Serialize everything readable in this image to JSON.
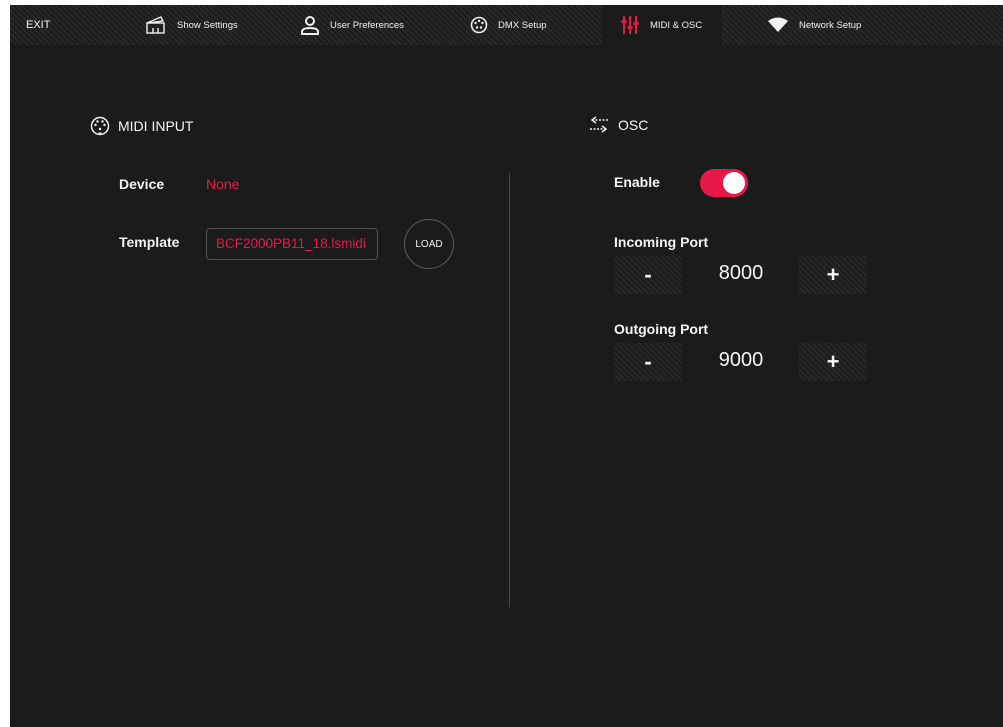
{
  "nav": {
    "exit_label": "EXIT",
    "tabs": [
      {
        "label": "Show Settings",
        "icon": "clapperboard-icon"
      },
      {
        "label": "User Preferences",
        "icon": "user-icon"
      },
      {
        "label": "DMX Setup",
        "icon": "dmx-connector-icon"
      },
      {
        "label": "MIDI & OSC",
        "icon": "sliders-icon",
        "active": true
      },
      {
        "label": "Network Setup",
        "icon": "wifi-icon"
      }
    ]
  },
  "midi": {
    "title": "MIDI INPUT",
    "device_label": "Device",
    "device_value": "None",
    "template_label": "Template",
    "template_value": "BCF2000PB11_18.lsmidi",
    "load_label": "LOAD"
  },
  "osc": {
    "title": "OSC",
    "enable_label": "Enable",
    "enabled": true,
    "incoming_label": "Incoming Port",
    "incoming_value": "8000",
    "outgoing_label": "Outgoing Port",
    "outgoing_value": "9000",
    "minus_label": "-",
    "plus_label": "+"
  },
  "colors": {
    "accent": "#e8174a",
    "background": "#1b1b1b",
    "text": "#f5f5f5"
  }
}
